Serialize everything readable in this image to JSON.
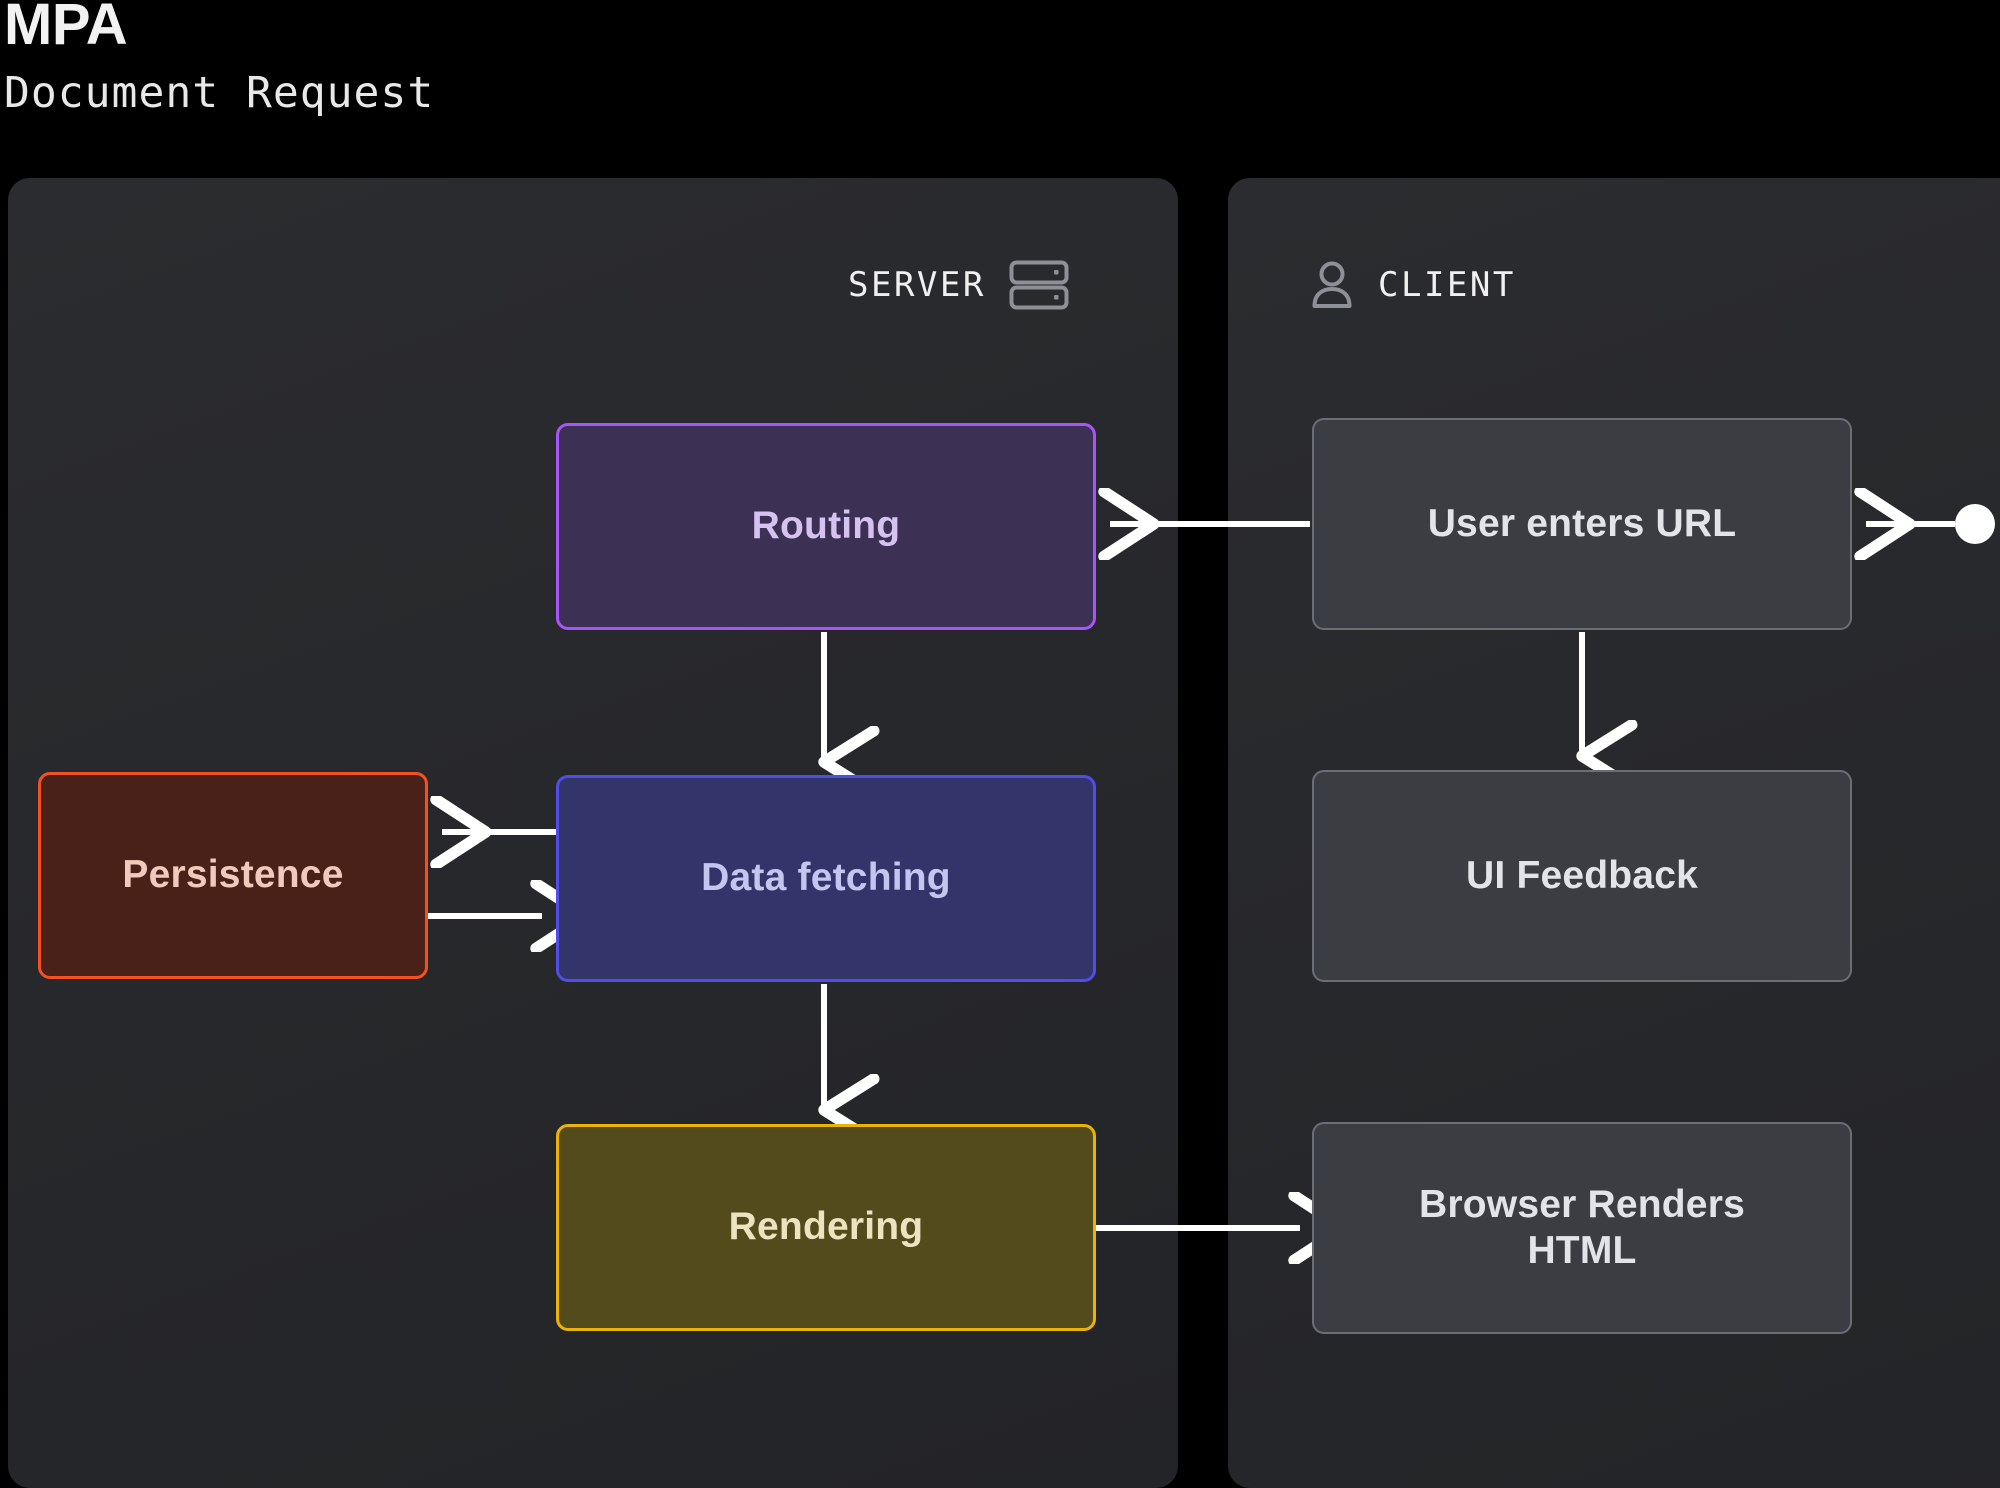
{
  "header": {
    "title": "MPA",
    "subtitle": "Document Request"
  },
  "panels": [
    {
      "id": "server",
      "label": "SERVER",
      "icon": "server-rack-icon",
      "icon_position": "right"
    },
    {
      "id": "client",
      "label": "CLIENT",
      "icon": "user-person-icon",
      "icon_position": "left"
    }
  ],
  "nodes": {
    "routing": {
      "label": "Routing",
      "panel": "server",
      "fill": "#3c3054",
      "border": "#a855f7",
      "text": "#d6c2f0"
    },
    "data_fetching": {
      "label": "Data fetching",
      "panel": "server",
      "fill": "#33356a",
      "border": "#4f4fe8",
      "text": "#c3c6ee"
    },
    "rendering": {
      "label": "Rendering",
      "panel": "server",
      "fill": "#544b1d",
      "border": "#eab308",
      "text": "#ece4c0"
    },
    "persistence": {
      "label": "Persistence",
      "panel": "server",
      "fill": "#4a2119",
      "border": "#f4511e",
      "text": "#f0cbbd"
    },
    "user_enters_url": {
      "label": "User enters URL",
      "panel": "client",
      "fill": "#3b3d42",
      "border": "#6a6e77",
      "text": "#e2e4e8"
    },
    "ui_feedback": {
      "label": "UI Feedback",
      "panel": "client",
      "fill": "#3b3d42",
      "border": "#6a6e77",
      "text": "#e2e4e8"
    },
    "browser_renders_html": {
      "label_line1": "Browser Renders",
      "label_line2": "HTML",
      "panel": "client",
      "fill": "#3b3d42",
      "border": "#6a6e77",
      "text": "#e2e4e8"
    }
  },
  "edges": [
    {
      "from": "entry-point",
      "to": "user_enters_url",
      "direction": "left",
      "style": "solid"
    },
    {
      "from": "user_enters_url",
      "to": "routing",
      "direction": "left",
      "style": "solid"
    },
    {
      "from": "user_enters_url",
      "to": "ui_feedback",
      "direction": "down",
      "style": "solid"
    },
    {
      "from": "routing",
      "to": "data_fetching",
      "direction": "down",
      "style": "solid"
    },
    {
      "from": "data_fetching",
      "to": "persistence",
      "direction": "left",
      "style": "solid"
    },
    {
      "from": "persistence",
      "to": "data_fetching",
      "direction": "right",
      "style": "solid"
    },
    {
      "from": "data_fetching",
      "to": "rendering",
      "direction": "down",
      "style": "solid"
    },
    {
      "from": "rendering",
      "to": "browser_renders_html",
      "direction": "right",
      "style": "solid"
    }
  ],
  "colors": {
    "background": "#000000",
    "panel": "#292a2d",
    "edge": "#ffffff",
    "entry_dot": "#ffffff"
  }
}
